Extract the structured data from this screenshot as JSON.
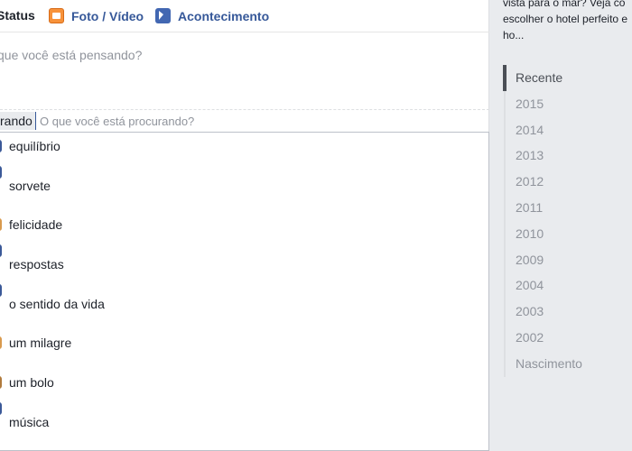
{
  "composer": {
    "tabs": [
      {
        "label": "Status"
      },
      {
        "label": "Foto / Vídeo"
      },
      {
        "label": "Acontecimento"
      }
    ],
    "status_placeholder": "que você está pensando?",
    "feeling_chip": "rando",
    "search_placeholder": "O que você está procurando?"
  },
  "suggestions": [
    {
      "label": "equilíbrio",
      "color": "#3b5998"
    },
    {
      "label": "sorvete",
      "color": "#3b5998"
    },
    {
      "label": "felicidade",
      "color": "#d99a4e"
    },
    {
      "label": "respostas",
      "color": "#3b5998"
    },
    {
      "label": "o sentido da vida",
      "color": "#3b5998"
    },
    {
      "label": "um milagre",
      "color": "#d99a4e"
    },
    {
      "label": "um bolo",
      "color": "#b07a3c"
    },
    {
      "label": "música",
      "color": "#3b5998"
    }
  ],
  "ad": {
    "line1": "vista para o mar? Veja co",
    "line2": "escolher o hotel perfeito e",
    "line3": "ho..."
  },
  "timeline": [
    "Recente",
    "2015",
    "2014",
    "2013",
    "2012",
    "2011",
    "2010",
    "2009",
    "2004",
    "2003",
    "2002",
    "Nascimento"
  ]
}
